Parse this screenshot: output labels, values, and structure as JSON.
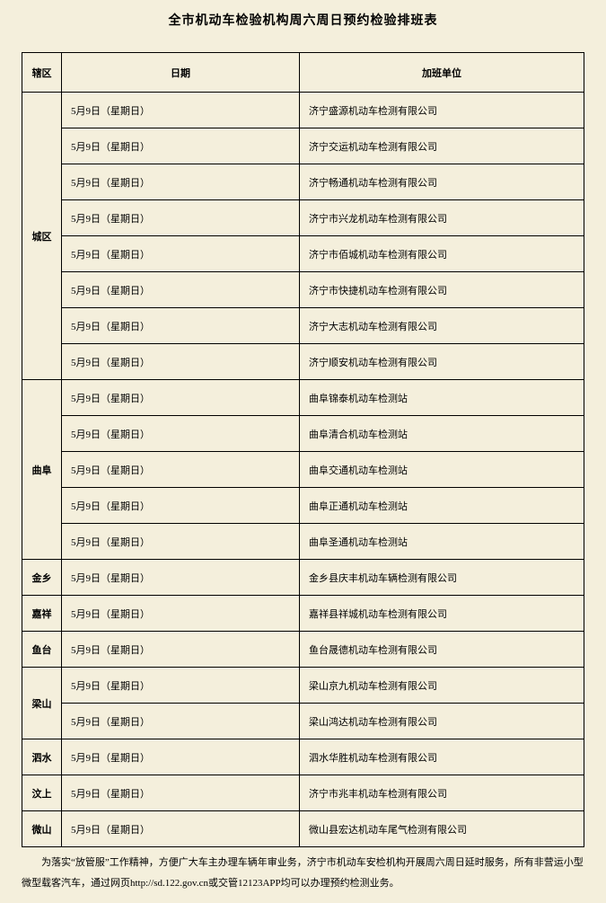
{
  "title": "全市机动车检验机构周六周日预约检验排班表",
  "headers": {
    "area": "辖区",
    "date": "日期",
    "unit": "加班单位"
  },
  "groups": [
    {
      "area": "城区",
      "rows": [
        {
          "date": "5月9日（星期日）",
          "unit": "济宁盛源机动车检测有限公司"
        },
        {
          "date": "5月9日（星期日）",
          "unit": "济宁交运机动车检测有限公司"
        },
        {
          "date": "5月9日（星期日）",
          "unit": "济宁畅通机动车检测有限公司"
        },
        {
          "date": "5月9日（星期日）",
          "unit": "济宁市兴龙机动车检测有限公司"
        },
        {
          "date": "5月9日（星期日）",
          "unit": "济宁市佰城机动车检测有限公司"
        },
        {
          "date": "5月9日（星期日）",
          "unit": "济宁市快捷机动车检测有限公司"
        },
        {
          "date": "5月9日（星期日）",
          "unit": "济宁大志机动车检测有限公司"
        },
        {
          "date": "5月9日（星期日）",
          "unit": "济宁顺安机动车检测有限公司"
        }
      ]
    },
    {
      "area": "曲阜",
      "rows": [
        {
          "date": "5月9日（星期日）",
          "unit": "曲阜锦泰机动车检测站"
        },
        {
          "date": "5月9日（星期日）",
          "unit": "曲阜清合机动车检测站"
        },
        {
          "date": "5月9日（星期日）",
          "unit": "曲阜交通机动车检测站"
        },
        {
          "date": "5月9日（星期日）",
          "unit": "曲阜正通机动车检测站"
        },
        {
          "date": "5月9日（星期日）",
          "unit": "曲阜圣通机动车检测站"
        }
      ]
    },
    {
      "area": "金乡",
      "rows": [
        {
          "date": "5月9日（星期日）",
          "unit": "金乡县庆丰机动车辆检测有限公司"
        }
      ]
    },
    {
      "area": "嘉祥",
      "rows": [
        {
          "date": "5月9日（星期日）",
          "unit": "嘉祥县祥城机动车检测有限公司"
        }
      ]
    },
    {
      "area": "鱼台",
      "rows": [
        {
          "date": "5月9日（星期日）",
          "unit": "鱼台晟德机动车检测有限公司"
        }
      ]
    },
    {
      "area": "梁山",
      "rows": [
        {
          "date": "5月9日（星期日）",
          "unit": "梁山京九机动车检测有限公司"
        },
        {
          "date": "5月9日（星期日）",
          "unit": "梁山鸿达机动车检测有限公司"
        }
      ]
    },
    {
      "area": "泗水",
      "rows": [
        {
          "date": "5月9日（星期日）",
          "unit": "泗水华胜机动车检测有限公司"
        }
      ]
    },
    {
      "area": "汶上",
      "rows": [
        {
          "date": "5月9日（星期日）",
          "unit": "济宁市兆丰机动车检测有限公司"
        }
      ]
    },
    {
      "area": "微山",
      "rows": [
        {
          "date": "5月9日（星期日）",
          "unit": "微山县宏达机动车尾气检测有限公司"
        }
      ]
    }
  ],
  "footer": "为落实“放管服”工作精神，方便广大车主办理车辆年审业务，济宁市机动车安检机构开展周六周日延时服务，所有非营运小型微型载客汽车，通过网页http://sd.122.gov.cn或交管12123APP均可以办理预约检测业务。"
}
